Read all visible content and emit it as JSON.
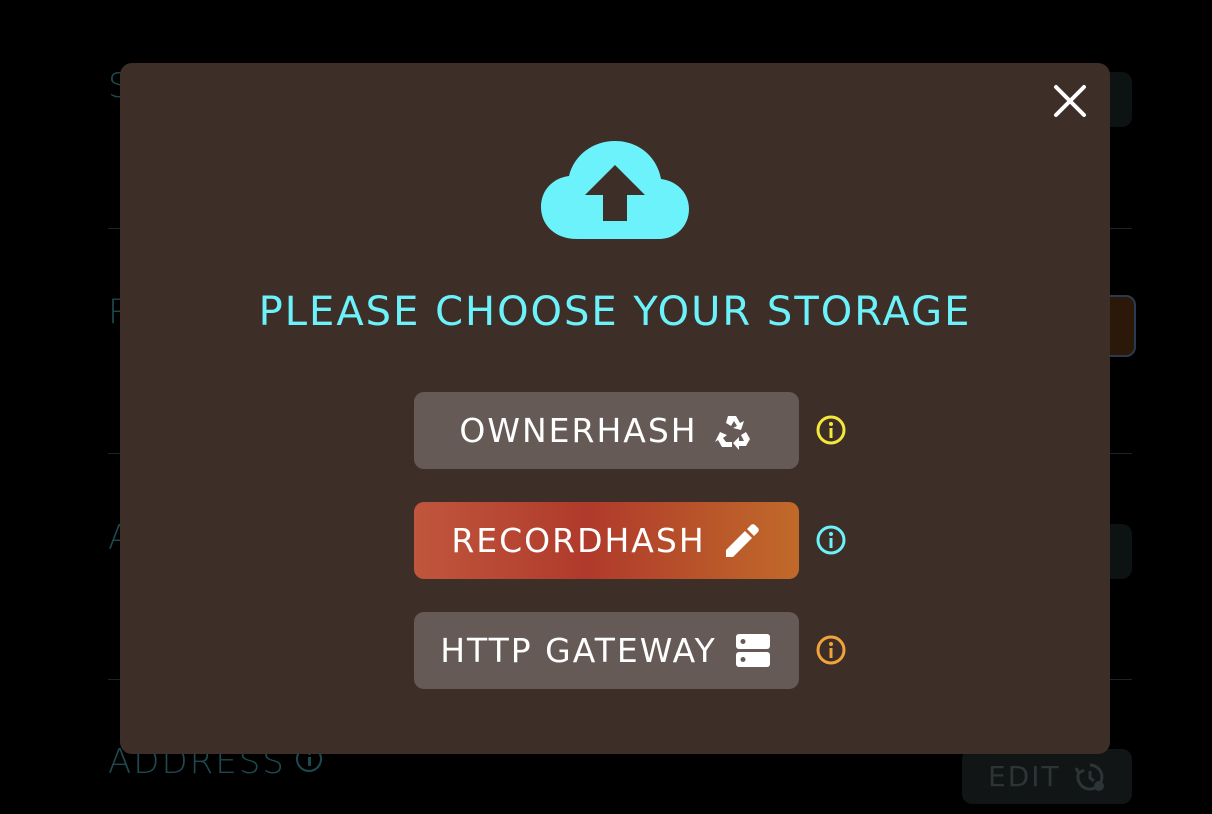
{
  "background": {
    "labels": [
      "S",
      "R",
      "A",
      "ADDRESS"
    ],
    "edit_label": "EDIT"
  },
  "modal": {
    "title": "PLEASE CHOOSE YOUR STORAGE",
    "icon": "cloud-upload-icon",
    "options": [
      {
        "label": "OWNERHASH",
        "icon": "recycle-icon",
        "info_color": "#f3e93a",
        "active": false
      },
      {
        "label": "RECORDHASH",
        "icon": "pencil-icon",
        "info_color": "#6cf2fb",
        "active": true
      },
      {
        "label": "HTTP GATEWAY",
        "icon": "server-icon",
        "info_color": "#f0a43a",
        "active": false
      }
    ]
  },
  "colors": {
    "accent": "#6cf2fb",
    "modal_bg": "#3e2e28",
    "button_grey": "#655a55"
  }
}
